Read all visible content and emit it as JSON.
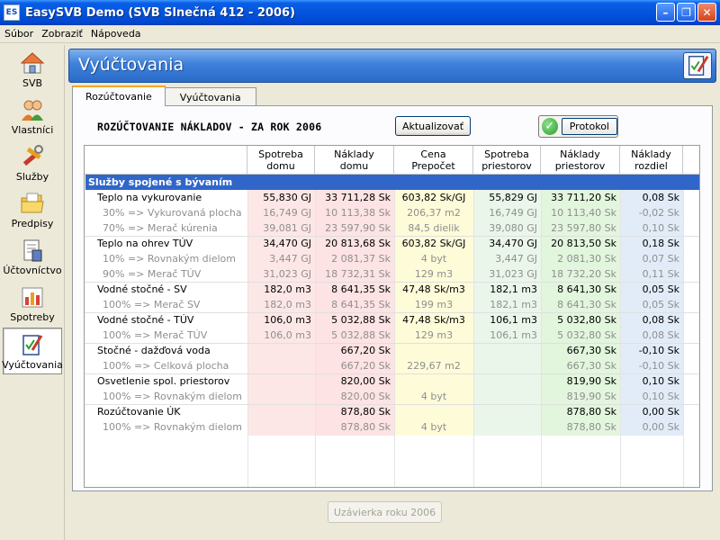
{
  "window": {
    "app_icon": "ES",
    "title": "EasySVB Demo  (SVB Slnečná 412 - 2006)",
    "buttons": [
      "minimize-icon",
      "restore-icon",
      "close-icon"
    ]
  },
  "menu": {
    "items": [
      "Súbor",
      "Zobraziť",
      "Nápoveda"
    ]
  },
  "sidebar": {
    "items": [
      {
        "label": "SVB",
        "icon": "home-icon"
      },
      {
        "label": "Vlastníci",
        "icon": "people-icon"
      },
      {
        "label": "Služby",
        "icon": "tools-icon"
      },
      {
        "label": "Predpisy",
        "icon": "folder-icon"
      },
      {
        "label": "Účtovníctvo",
        "icon": "ledger-icon"
      },
      {
        "label": "Spotreby",
        "icon": "bar-chart-icon"
      },
      {
        "label": "Vyúčtovania",
        "icon": "clipboard-pen-icon",
        "active": true
      }
    ]
  },
  "header": {
    "title": "Vyúčtovania",
    "icon": "clipboard-pen-icon"
  },
  "tabs": [
    {
      "label": "Rozúčtovanie",
      "active": true
    },
    {
      "label": "Vyúčtovania",
      "active": false
    }
  ],
  "section": {
    "title": "ROZÚČTOVANIE NÁKLADOV - ZA ROK 2006",
    "update_button": "Aktualizovať",
    "protocol_button": "Protokol"
  },
  "colors": {
    "consumption_house": "#fde7e6",
    "costs_house": "#fde3e3",
    "unit_price": "#fefbd9",
    "consumption_space": "#eaf6ea",
    "costs_space": "#e2f5dd",
    "difference": "#e2ecf8",
    "group_header": "#3166c9"
  },
  "table": {
    "headers": [
      "Spotreba\ndomu",
      "Náklady\ndomu",
      "Cena\nPrepočet",
      "Spotreba\npriestorov",
      "Náklady\npriestorov",
      "Náklady\nrozdiel"
    ],
    "group": "Služby spojené s bývaním",
    "rows": [
      [
        "Teplo na vykurovanie",
        "55,830 GJ",
        "33 711,28 Sk",
        "603,82 Sk/GJ",
        "55,829 GJ",
        "33 711,20 Sk",
        "0,08 Sk",
        false
      ],
      [
        "30% => Vykurovaná plocha",
        "16,749 GJ",
        "10 113,38 Sk",
        "206,37 m2",
        "16,749 GJ",
        "10 113,40 Sk",
        "-0,02 Sk",
        true
      ],
      [
        "70% => Merač kúrenia",
        "39,081 GJ",
        "23 597,90 Sk",
        "84,5 dielik",
        "39,080 GJ",
        "23 597,80 Sk",
        "0,10 Sk",
        true
      ],
      [
        "Teplo na ohrev TÚV",
        "34,470 GJ",
        "20 813,68 Sk",
        "603,82 Sk/GJ",
        "34,470 GJ",
        "20 813,50 Sk",
        "0,18 Sk",
        false
      ],
      [
        "10% => Rovnakým dielom",
        "3,447 GJ",
        "2 081,37 Sk",
        "4 byt",
        "3,447 GJ",
        "2 081,30 Sk",
        "0,07 Sk",
        true
      ],
      [
        "90% => Merač TÚV",
        "31,023 GJ",
        "18 732,31 Sk",
        "129 m3",
        "31,023 GJ",
        "18 732,20 Sk",
        "0,11 Sk",
        true
      ],
      [
        "Vodné stočné - SV",
        "182,0 m3",
        "8 641,35 Sk",
        "47,48 Sk/m3",
        "182,1 m3",
        "8 641,30 Sk",
        "0,05 Sk",
        false
      ],
      [
        "100% => Merač SV",
        "182,0 m3",
        "8 641,35 Sk",
        "199 m3",
        "182,1 m3",
        "8 641,30 Sk",
        "0,05 Sk",
        true
      ],
      [
        "Vodné stočné - TÚV",
        "106,0 m3",
        "5 032,88 Sk",
        "47,48 Sk/m3",
        "106,1 m3",
        "5 032,80 Sk",
        "0,08 Sk",
        false
      ],
      [
        "100% => Merač TÚV",
        "106,0 m3",
        "5 032,88 Sk",
        "129 m3",
        "106,1 m3",
        "5 032,80 Sk",
        "0,08 Sk",
        true
      ],
      [
        "Stočné - dažďová voda",
        "",
        "667,20 Sk",
        "",
        "",
        "667,30 Sk",
        "-0,10 Sk",
        false
      ],
      [
        "100% => Celková plocha",
        "",
        "667,20 Sk",
        "229,67 m2",
        "",
        "667,30 Sk",
        "-0,10 Sk",
        true
      ],
      [
        "Osvetlenie spol. priestorov",
        "",
        "820,00 Sk",
        "",
        "",
        "819,90 Sk",
        "0,10 Sk",
        false
      ],
      [
        "100% => Rovnakým dielom",
        "",
        "820,00 Sk",
        "4 byt",
        "",
        "819,90 Sk",
        "0,10 Sk",
        true
      ],
      [
        "Rozúčtovanie ÚK",
        "",
        "878,80 Sk",
        "",
        "",
        "878,80 Sk",
        "0,00 Sk",
        false
      ],
      [
        "100% => Rovnakým dielom",
        "",
        "878,80 Sk",
        "4 byt",
        "",
        "878,80 Sk",
        "0,00 Sk",
        true
      ]
    ]
  },
  "footer": {
    "close_year_button": "Uzávierka roku 2006"
  }
}
